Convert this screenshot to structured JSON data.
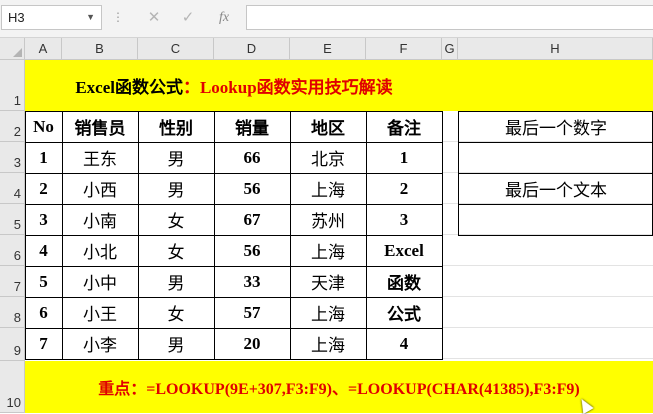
{
  "formula_bar": {
    "name_box": "H3",
    "cancel_icon": "✕",
    "enter_icon": "✓",
    "fx_label": "fx",
    "formula": ""
  },
  "columns": [
    "A",
    "B",
    "C",
    "D",
    "E",
    "F",
    "G",
    "H"
  ],
  "rows": [
    "1",
    "2",
    "3",
    "4",
    "5",
    "6",
    "7",
    "8",
    "9",
    "10"
  ],
  "title": {
    "part1": "Excel函数公式",
    "part2": "：Lookup函数实用技巧解读"
  },
  "table": {
    "headers": [
      "No",
      "销售员",
      "性别",
      "销量",
      "地区",
      "备注"
    ],
    "rows": [
      [
        "1",
        "王东",
        "男",
        "66",
        "北京",
        "1"
      ],
      [
        "2",
        "小西",
        "男",
        "56",
        "上海",
        "2"
      ],
      [
        "3",
        "小南",
        "女",
        "67",
        "苏州",
        "3"
      ],
      [
        "4",
        "小北",
        "女",
        "56",
        "上海",
        "Excel"
      ],
      [
        "5",
        "小中",
        "男",
        "33",
        "天津",
        "函数"
      ],
      [
        "6",
        "小王",
        "女",
        "57",
        "上海",
        "公式"
      ],
      [
        "7",
        "小李",
        "男",
        "20",
        "上海",
        "4"
      ]
    ]
  },
  "side": {
    "last_number_label": "最后一个数字",
    "last_number_value": "",
    "last_text_label": "最后一个文本",
    "last_text_value": ""
  },
  "note": "重点：=LOOKUP(9E+307,F3:F9)、=LOOKUP(CHAR(41385),F3:F9)",
  "colors": {
    "highlight": "#ffff00",
    "accent_red": "#e00000"
  }
}
